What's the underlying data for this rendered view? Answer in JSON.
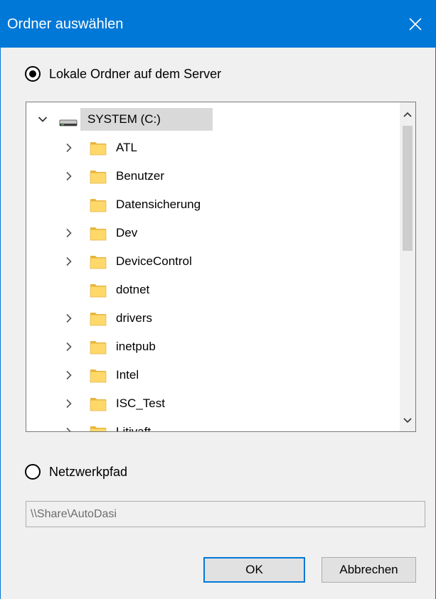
{
  "dialog": {
    "title": "Ordner auswählen",
    "accent_color": "#0078d7",
    "close_icon": "close-icon"
  },
  "options": {
    "local": {
      "label": "Lokale Ordner auf dem Server",
      "selected": true
    },
    "network": {
      "label": "Netzwerkpfad",
      "selected": false
    }
  },
  "tree": {
    "root": {
      "label": "SYSTEM (C:)",
      "icon": "drive-icon",
      "expanded": true
    },
    "folders": [
      {
        "label": "ATL",
        "has_children": true
      },
      {
        "label": "Benutzer",
        "has_children": true
      },
      {
        "label": "Datensicherung",
        "has_children": false
      },
      {
        "label": "Dev",
        "has_children": true
      },
      {
        "label": "DeviceControl",
        "has_children": true
      },
      {
        "label": "dotnet",
        "has_children": false
      },
      {
        "label": "drivers",
        "has_children": true
      },
      {
        "label": "inetpub",
        "has_children": true
      },
      {
        "label": "Intel",
        "has_children": true
      },
      {
        "label": "ISC_Test",
        "has_children": true
      },
      {
        "label": "Litiyaft",
        "has_children": true
      }
    ]
  },
  "network_path": {
    "value": "\\\\Share\\AutoDasi"
  },
  "buttons": {
    "ok": "OK",
    "cancel": "Abbrechen"
  }
}
